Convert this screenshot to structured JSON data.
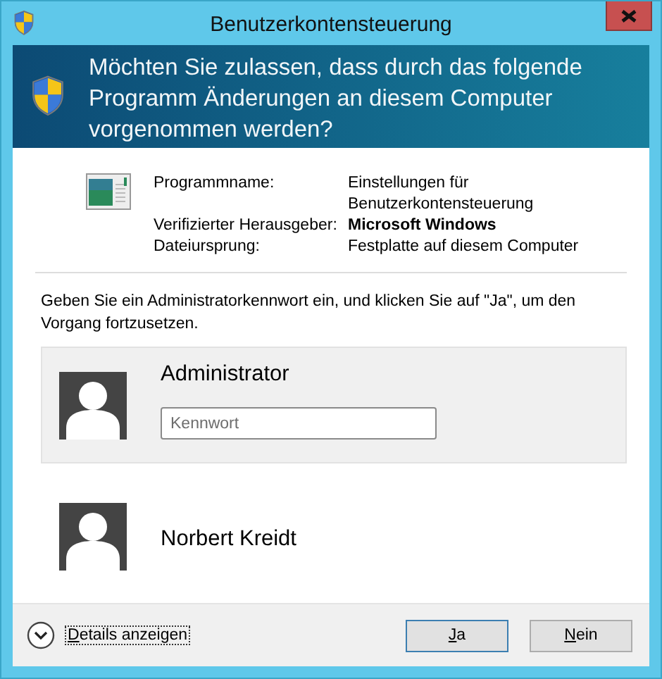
{
  "window": {
    "title": "Benutzerkontensteuerung"
  },
  "header": {
    "question": "Möchten Sie zulassen, dass durch das folgende Programm Änderungen an diesem Computer vorgenommen werden?"
  },
  "program_info": [
    {
      "label": "Programmname:",
      "value": "Einstellungen für Benutzerkontensteuerung",
      "bold": false
    },
    {
      "label": "Verifizierter Herausgeber:",
      "value": "Microsoft Windows",
      "bold": true
    },
    {
      "label": "Dateiursprung:",
      "value": "Festplatte auf diesem Computer",
      "bold": false
    }
  ],
  "instruction": "Geben Sie ein Administratorkennwort ein, und klicken Sie auf \"Ja\", um den Vorgang fortzusetzen.",
  "users": [
    {
      "name": "Administrator",
      "selected": true,
      "password": {
        "placeholder": "Kennwort"
      }
    },
    {
      "name": "Norbert Kreidt",
      "selected": false
    }
  ],
  "footer": {
    "details": {
      "label": "Details anzeigen",
      "first_letter_underlined": true
    },
    "buttons": [
      {
        "label": "Ja",
        "first_letter_underlined": true,
        "default": true
      },
      {
        "label": "Nein",
        "first_letter_underlined": true,
        "default": false
      }
    ]
  }
}
